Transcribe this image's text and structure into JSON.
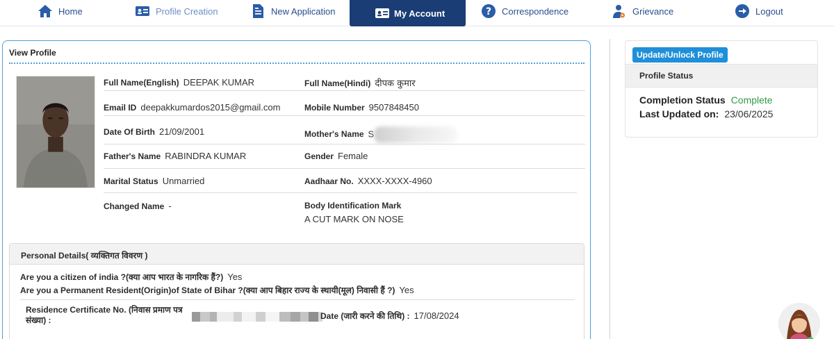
{
  "nav": {
    "home": "Home",
    "profile_creation": "Profile Creation",
    "new_application": "New Application",
    "my_account": "My Account",
    "correspondence": "Correspondence",
    "grievance": "Grievance",
    "logout": "Logout"
  },
  "view_profile": {
    "title": "View Profile",
    "full_name_en_label": "Full Name(English)",
    "full_name_en": "DEEPAK KUMAR",
    "full_name_hi_label": "Full Name(Hindi)",
    "full_name_hi": "दीपक कुमार",
    "email_label": "Email ID",
    "email": "deepakkumardos2015@gmail.com",
    "mobile_label": "Mobile Number",
    "mobile": "9507848450",
    "dob_label": "Date Of Birth",
    "dob": "21/09/2001",
    "mother_label": "Mother's Name",
    "mother_initial": "S",
    "father_label": "Father's Name",
    "father": "RABINDRA KUMAR",
    "gender_label": "Gender",
    "gender": "Female",
    "marital_label": "Marital Status",
    "marital": "Unmarried",
    "aadhaar_label": "Aadhaar No.",
    "aadhaar": "XXXX-XXXX-4960",
    "changed_name_label": "Changed Name",
    "changed_name": "-",
    "body_mark_label": "Body Identification Mark",
    "body_mark": "A CUT MARK ON NOSE"
  },
  "personal_details": {
    "title": "Personal Details( व्यक्तिगत विवरण )",
    "citizen_q": "Are you a citizen of india ?(क्या आप भारत के नागरिक हैं?)",
    "citizen_a": "Yes",
    "resident_q": "Are you a Permanent Resident(Origin)of State of Bihar ?(क्या आप बिहार राज्य के स्थायी(मूल) निवासी हैं ?)",
    "resident_a": "Yes",
    "rc_label": "Residence Certificate No. (निवास प्रमाण पत्र संख्या) :",
    "date_label": "Date (जारी करने की तिथि) :",
    "date": "17/08/2024"
  },
  "profile_status": {
    "button": "Update/Unlock Profile",
    "title": "Profile Status",
    "completion_label": "Completion Status",
    "completion": "Complete",
    "updated_label": "Last Updated on:",
    "updated": "23/06/2025"
  },
  "colors": {
    "nav_active": "#1b3d75",
    "link": "#2a4d8f",
    "accent_blue": "#1f8fd9",
    "complete_green": "#2f9a4b"
  }
}
